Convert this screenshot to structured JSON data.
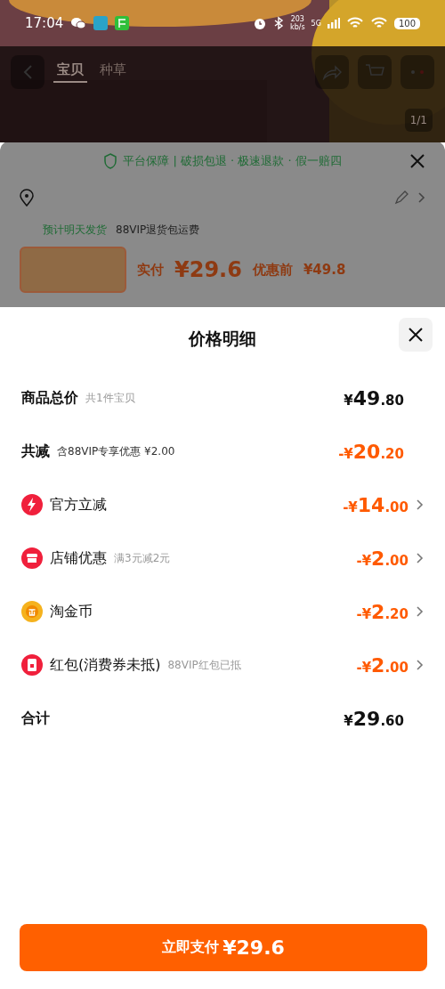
{
  "status_bar": {
    "time": "17:04",
    "speed": "203",
    "speed_unit": "kb/s",
    "network": "5G",
    "battery": "100"
  },
  "product_nav": {
    "tabs": [
      {
        "label": "宝贝",
        "selected": true
      },
      {
        "label": "种草",
        "selected": false
      }
    ],
    "pager": "1/1"
  },
  "order_sheet": {
    "guarantee": "平台保障 | 破损包退 · 极速退款 · 假一赔四",
    "delivery": "预计明天发货",
    "shipping_note": "88VIP退货包运费",
    "paid_label": "实付",
    "paid_amount": "¥29.6",
    "before_label": "优惠前",
    "before_amount": "¥49.8"
  },
  "price_detail": {
    "title": "价格明细",
    "rows": [
      {
        "kind": "plain",
        "label": "商品总价",
        "note": "共1件宝贝",
        "amount": "¥49.80",
        "discount": false,
        "arrow": false
      },
      {
        "kind": "plain",
        "label": "共减",
        "note": "含88VIP专享优惠 ¥2.00",
        "amount": "-¥20.20",
        "discount": true,
        "arrow": false
      },
      {
        "kind": "lightning",
        "color": "#f0203c",
        "label": "官方立减",
        "amount": "-¥14.00",
        "discount": true,
        "arrow": true
      },
      {
        "kind": "shop",
        "color": "#f0203c",
        "label": "店铺优惠",
        "note": "满3元减2元",
        "amount": "-¥2.00",
        "discount": true,
        "arrow": true
      },
      {
        "kind": "coin",
        "color": "#f5b21e",
        "label": "淘金币",
        "amount": "-¥2.20",
        "discount": true,
        "arrow": true
      },
      {
        "kind": "envelope",
        "color": "#f0203c",
        "label": "红包(消费券未抵)",
        "note": "88VIP红包已抵",
        "amount": "-¥2.00",
        "discount": true,
        "arrow": true
      },
      {
        "kind": "plain",
        "label": "合计",
        "amount": "¥29.60",
        "discount": false,
        "arrow": false
      }
    ],
    "pay_label": "立即支付",
    "pay_amount": "¥29.6"
  }
}
